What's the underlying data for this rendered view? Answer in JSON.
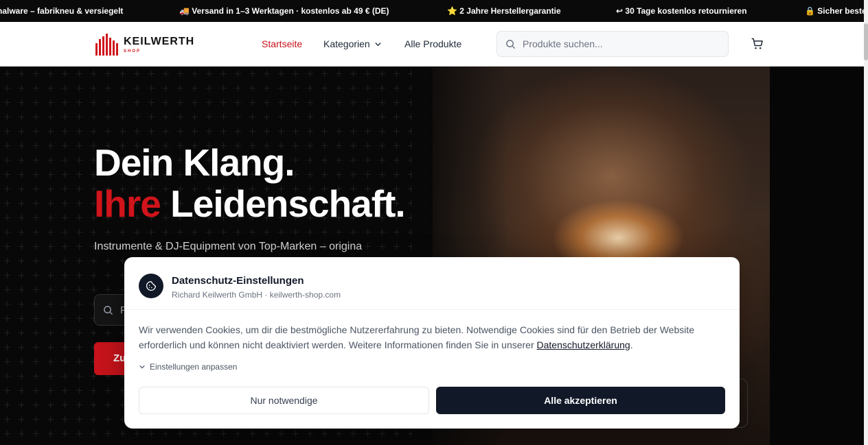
{
  "ticker": {
    "items": [
      "nalware – fabrikneu & versiegelt",
      "🚚 Versand in 1–3 Werktagen · kostenlos ab 49 € (DE)",
      "⭐ 2 Jahre Herstellergarantie",
      "↩ 30 Tage kostenlos retournieren",
      "🔒 Sicher beste"
    ]
  },
  "header": {
    "logo_name": "KEILWERTH",
    "logo_sub": "SHOP",
    "nav": {
      "home": "Startseite",
      "categories": "Kategorien",
      "all_products": "Alle Produkte"
    },
    "search_placeholder": "Produkte suchen..."
  },
  "hero": {
    "headline_line1": "Dein Klang.",
    "headline_line2_accent": "Ihre",
    "headline_line2_rest": " Leidenschaft.",
    "subtitle": "Instrumente & DJ-Equipment von Top-Marken – origina",
    "search_placeholder": "P",
    "cta_label": "Zu"
  },
  "cookie_dialog": {
    "title": "Datenschutz-Einstellungen",
    "subtitle": "Richard Keilwerth GmbH · keilwerth-shop.com",
    "body": "Wir verwenden Cookies, um dir die bestmögliche Nutzererfahrung zu bieten. Notwendige Cookies sind für den Betrieb der Website erforderlich und können nicht deaktiviert werden. Weitere Informationen finden Sie in unserer ",
    "privacy_link": "Datenschutzerklärung",
    "body_end": ".",
    "settings_toggle": "Einstellungen anpassen",
    "necessary_button": "Nur notwendige",
    "accept_button": "Alle akzeptieren"
  },
  "colors": {
    "accent": "#c8131b",
    "dark": "#111827"
  }
}
